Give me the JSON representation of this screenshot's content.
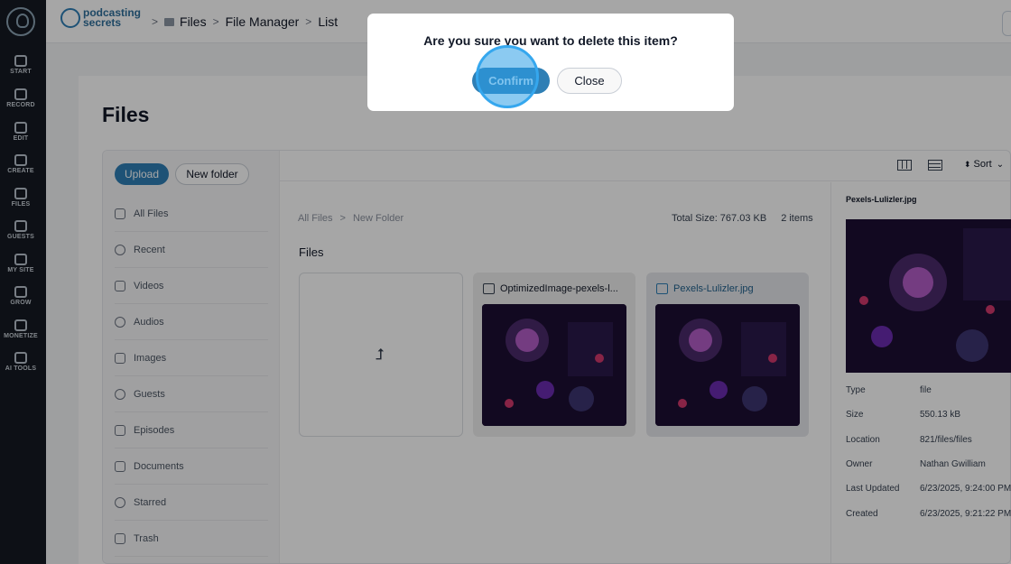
{
  "rail": {
    "items": [
      {
        "label": "START",
        "icon": "start-icon"
      },
      {
        "label": "RECORD",
        "icon": "mic-icon"
      },
      {
        "label": "EDIT",
        "icon": "edit-icon"
      },
      {
        "label": "CREATE",
        "icon": "create-icon"
      },
      {
        "label": "FILES",
        "icon": "files-icon"
      },
      {
        "label": "GUESTS",
        "icon": "guests-icon"
      },
      {
        "label": "MY SITE",
        "icon": "site-icon"
      },
      {
        "label": "GROW",
        "icon": "grow-icon"
      },
      {
        "label": "MONETIZE",
        "icon": "monetize-icon"
      },
      {
        "label": "AI TOOLS",
        "icon": "ai-icon"
      }
    ]
  },
  "header": {
    "brand_line1": "podcasting",
    "brand_line2": "secrets",
    "breadcrumbs": [
      "Files",
      "File Manager",
      "List"
    ]
  },
  "page": {
    "title": "Files"
  },
  "sidebar": {
    "upload_label": "Upload",
    "new_folder_label": "New folder",
    "items": [
      {
        "label": "All Files",
        "icon": "folder-icon"
      },
      {
        "label": "Recent",
        "icon": "clock-icon"
      },
      {
        "label": "Videos",
        "icon": "video-icon"
      },
      {
        "label": "Audios",
        "icon": "music-icon"
      },
      {
        "label": "Images",
        "icon": "image-icon"
      },
      {
        "label": "Guests",
        "icon": "users-icon"
      },
      {
        "label": "Episodes",
        "icon": "episodes-icon"
      },
      {
        "label": "Documents",
        "icon": "document-icon"
      },
      {
        "label": "Starred",
        "icon": "star-icon"
      },
      {
        "label": "Trash",
        "icon": "trash-icon"
      }
    ]
  },
  "toolbar": {
    "sort_label": "Sort"
  },
  "content": {
    "path": [
      "All Files",
      "New Folder"
    ],
    "total_size": "Total Size: 767.03 KB",
    "item_count": "2 items",
    "section_label": "Files",
    "files": [
      {
        "name": "OptimizedImage-pexels-l..."
      },
      {
        "name": "Pexels-Lulizler.jpg"
      }
    ]
  },
  "details": {
    "name": "Pexels-Lulizler.jpg",
    "rows": [
      {
        "key": "Type",
        "value": "file"
      },
      {
        "key": "Size",
        "value": "550.13 kB"
      },
      {
        "key": "Location",
        "value": "821/files/files"
      },
      {
        "key": "Owner",
        "value": "Nathan Gwilliam"
      },
      {
        "key": "Last Updated",
        "value": "6/23/2025, 9:24:00 PM"
      },
      {
        "key": "Created",
        "value": "6/23/2025, 9:21:22 PM"
      }
    ]
  },
  "modal": {
    "title": "Are you sure you want to delete this item?",
    "confirm_label": "Confirm",
    "close_label": "Close"
  },
  "colors": {
    "accent": "#2f7fb5",
    "rail": "#141a22"
  }
}
